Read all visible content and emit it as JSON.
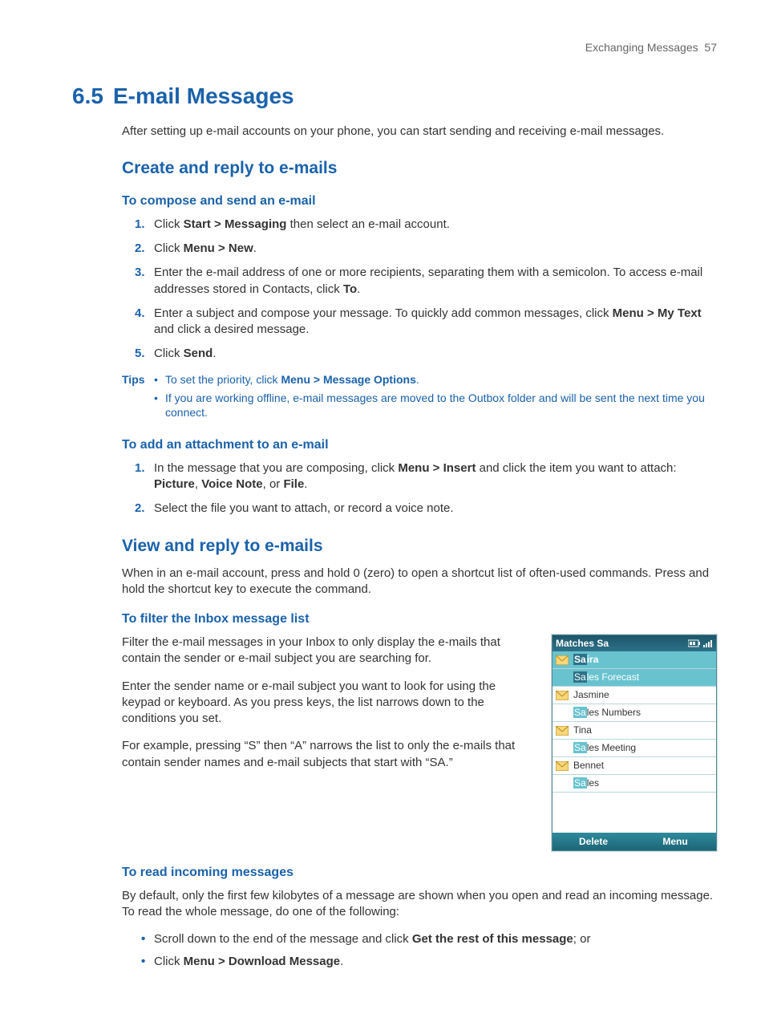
{
  "header": {
    "chapter": "Exchanging Messages",
    "page": "57"
  },
  "h1": {
    "num": "6.5",
    "title": "E-mail Messages"
  },
  "intro": "After setting up e-mail accounts on your phone, you can start sending and receiving e-mail messages.",
  "sec1": {
    "title": "Create and reply to e-mails",
    "sub1": {
      "title": "To compose and send an e-mail",
      "steps": {
        "s1a": "Click ",
        "s1b": "Start > Messaging",
        "s1c": " then select an e-mail account.",
        "s2a": "Click ",
        "s2b": "Menu > New",
        "s2c": ".",
        "s3a": "Enter the e-mail address of one or more recipients, separating them with a semicolon. To access e-mail addresses stored in Contacts, click ",
        "s3b": "To",
        "s3c": ".",
        "s4a": "Enter a subject and compose your message. To quickly add common messages, click ",
        "s4b": "Menu > My Text",
        "s4c": " and click a desired message.",
        "s5a": "Click ",
        "s5b": "Send",
        "s5c": "."
      }
    },
    "tips": {
      "label": "Tips",
      "t1a": "To set the priority, click ",
      "t1b": "Menu > Message Options",
      "t1c": ".",
      "t2": "If you are working offline, e-mail messages are moved to the Outbox folder and will be sent the next time you connect."
    },
    "sub2": {
      "title": "To add an attachment to an e-mail",
      "steps": {
        "s1a": "In the message that you are composing, click ",
        "s1b": "Menu > Insert",
        "s1c": " and click the item you want to attach: ",
        "s1d": "Picture",
        "s1e": ", ",
        "s1f": "Voice Note",
        "s1g": ", or ",
        "s1h": "File",
        "s1i": ".",
        "s2": "Select the file you want to attach, or record a voice note."
      }
    }
  },
  "sec2": {
    "title": "View and reply to e-mails",
    "intro": "When in an e-mail account, press and hold 0 (zero) to open a shortcut list of often-used commands. Press and hold the shortcut key to execute the command.",
    "sub1": {
      "title": "To filter the Inbox message list",
      "p1": "Filter the e-mail messages in your Inbox to only display the e-mails that contain the sender or e-mail subject you are searching for.",
      "p2": "Enter the sender name or e-mail subject you want to look for using the keypad or keyboard. As you press keys, the list narrows down to the conditions you set.",
      "p3": "For example, pressing “S” then “A” narrows the list to only the e-mails that contain sender names and e-mail subjects that start with “SA.”"
    },
    "sub2": {
      "title": "To read incoming messages",
      "intro": "By default, only the first few kilobytes of a message are shown when you open and read an incoming message. To read the whole message, do one of the following:",
      "b1a": "Scroll down to the end of the message and click ",
      "b1b": "Get the rest of this message",
      "b1c": "; or",
      "b2a": "Click ",
      "b2b": "Menu > Download Message",
      "b2c": "."
    }
  },
  "phone": {
    "title": "Matches Sa",
    "rows": [
      {
        "hl": "Sa",
        "rest_sender": "ira",
        "rest_subject": "les Forecast"
      },
      {
        "sender": "Jasmine",
        "rest_subject": "les Numbers"
      },
      {
        "sender": "Tina",
        "rest_subject": "les Meeting"
      },
      {
        "sender": "Bennet",
        "rest_subject": "les"
      }
    ],
    "left": "Delete",
    "right": "Menu"
  }
}
